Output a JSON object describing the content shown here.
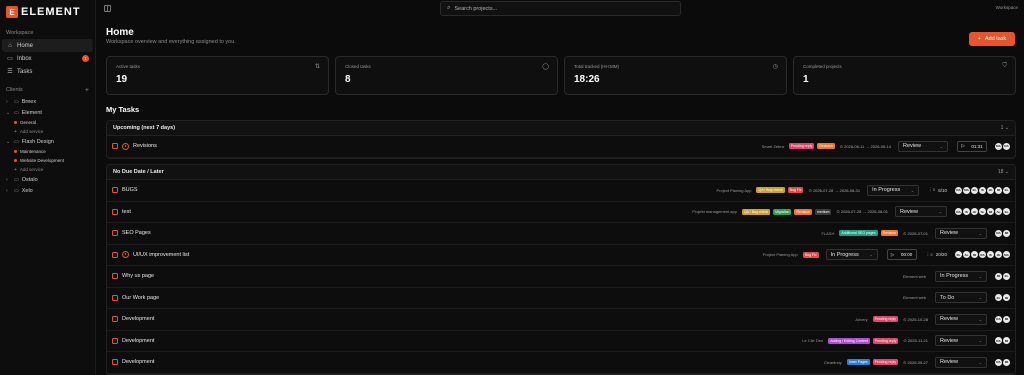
{
  "app": {
    "logo_letter": "E",
    "name": "ELEMENT",
    "accent": "#e8552d"
  },
  "sidebar": {
    "workspace_label": "Workspace",
    "nav": [
      {
        "label": "Home",
        "icon": "home-icon"
      },
      {
        "label": "Inbox",
        "icon": "inbox-icon",
        "badge": "1"
      },
      {
        "label": "Tasks",
        "icon": "tasks-icon"
      }
    ],
    "clients_label": "Clients",
    "clients_add": "+",
    "clients": [
      {
        "name": "Breex",
        "expanded": false,
        "services": [],
        "add": ""
      },
      {
        "name": "Element",
        "expanded": true,
        "services": [
          "General"
        ],
        "add": "Add service"
      },
      {
        "name": "Flash Design",
        "expanded": true,
        "services": [
          "Maintenance",
          "Website Development"
        ],
        "add": "Add service"
      },
      {
        "name": "Ostalo",
        "expanded": false,
        "services": [],
        "add": ""
      },
      {
        "name": "Xelo",
        "expanded": false,
        "services": [],
        "add": ""
      }
    ]
  },
  "topbar": {
    "search_placeholder": "Search projects...",
    "workspace": "Workspace"
  },
  "header": {
    "title": "Home",
    "subtitle": "Workspace overview and everything assigned to you.",
    "add_task": "Add task"
  },
  "stats": [
    {
      "label": "Active tasks",
      "value": "19",
      "icon": "sliders-icon"
    },
    {
      "label": "Closed tasks",
      "value": "8",
      "icon": "check-circle-icon"
    },
    {
      "label": "Total tracked (HH:MM)",
      "value": "18:26",
      "icon": "clock-icon"
    },
    {
      "label": "Completed projects",
      "value": "1",
      "icon": "badge-icon"
    }
  ],
  "my_tasks_title": "My Tasks",
  "groups": [
    {
      "title": "Upcoming (next 7 days)",
      "count": "1",
      "rows": [
        {
          "title": "Revisions",
          "overdue": true,
          "project": "Smart Zebra",
          "tags": [
            {
              "text": "Pending reply",
              "color": "#e0466b"
            },
            {
              "text": "Revision",
              "color": "#e8792d"
            }
          ],
          "date": "2026-06-11 → 2026-06-14",
          "status": "Review",
          "timer": "01:31",
          "subtasks": "",
          "avatars": [
            "MA",
            "RA"
          ]
        }
      ]
    },
    {
      "title": "No Due Date / Later",
      "count": "18",
      "rows": [
        {
          "title": "BUGS",
          "overdue": false,
          "project": "Project Planing App",
          "tags": [
            {
              "text": "QA / Bug check",
              "color": "#c9a227"
            },
            {
              "text": "Bug Fix",
              "color": "#e24a4a"
            }
          ],
          "date": "2026-07-28 → 2026-08-31",
          "status": "In Progress",
          "timer": "",
          "subtasks": "6/10",
          "avatars": [
            "RA",
            "MA",
            "EL",
            "IS",
            "JE",
            "MI",
            "EL"
          ]
        },
        {
          "title": "test",
          "overdue": false,
          "project": "Projekt management app",
          "tags": [
            {
              "text": "QA / Bug check",
              "color": "#c9a227"
            },
            {
              "text": "Migration",
              "color": "#2f9e58"
            },
            {
              "text": "Revision",
              "color": "#e8792d"
            },
            {
              "text": "medium",
              "color": "#3a3a3a"
            }
          ],
          "date": "2026-07-28 → 2026-08-01",
          "status": "Review",
          "timer": "",
          "subtasks": "",
          "avatars": [
            "RA",
            "IS",
            "JE",
            "SL",
            "MI",
            "AL",
            "EL"
          ]
        },
        {
          "title": "SEO Pages",
          "overdue": false,
          "project": "FLASH",
          "tags": [
            {
              "text": "Additional SEO pages",
              "color": "#1f9e84"
            },
            {
              "text": "Revision",
              "color": "#e8792d"
            }
          ],
          "date": "2026-07-01",
          "status": "Review",
          "timer": "",
          "subtasks": "",
          "avatars": [
            "RA",
            "MI"
          ]
        },
        {
          "title": "UI/UX improvement list",
          "overdue": true,
          "project": "Project Planing App",
          "tags": [
            {
              "text": "Bug Fix",
              "color": "#e24a4a"
            }
          ],
          "date": "",
          "status": "In Progress",
          "timer": "00:00",
          "subtasks": "20/20",
          "avatars": [
            "EL",
            "AL",
            "MI",
            "RA",
            "IS",
            "JE",
            "MA"
          ]
        },
        {
          "title": "Why us page",
          "overdue": false,
          "project": "Element web",
          "tags": [],
          "date": "",
          "status": "In Progress",
          "timer": "",
          "subtasks": "",
          "avatars": [
            "MI",
            "EL"
          ]
        },
        {
          "title": "Our Work page",
          "overdue": false,
          "project": "Element web",
          "tags": [],
          "date": "",
          "status": "To Do",
          "timer": "",
          "subtasks": "",
          "avatars": [
            "EL",
            "MI"
          ]
        },
        {
          "title": "Development",
          "overdue": false,
          "project": "Jolvery",
          "tags": [
            {
              "text": "Pending reply",
              "color": "#e0466b"
            }
          ],
          "date": "2025-10-28",
          "status": "Review",
          "timer": "",
          "subtasks": "",
          "avatars": [
            "RA",
            "MI"
          ]
        },
        {
          "title": "Development",
          "overdue": false,
          "project": "Le Cile Deo",
          "tags": [
            {
              "text": "Adding / Editing Content",
              "color": "#b34ad6"
            },
            {
              "text": "Pending reply",
              "color": "#e0466b"
            }
          ],
          "date": "2025-11-21",
          "status": "Review",
          "timer": "",
          "subtasks": "",
          "avatars": [
            "RA",
            "MI"
          ]
        },
        {
          "title": "Development",
          "overdue": false,
          "project": "Clearfirsty",
          "tags": [
            {
              "text": "Inner Pages",
              "color": "#2f7fd6"
            },
            {
              "text": "Pending reply",
              "color": "#e0466b"
            }
          ],
          "date": "2026-05-27",
          "status": "Review",
          "timer": "",
          "subtasks": "",
          "avatars": [
            "RA",
            "MI"
          ]
        }
      ]
    }
  ]
}
